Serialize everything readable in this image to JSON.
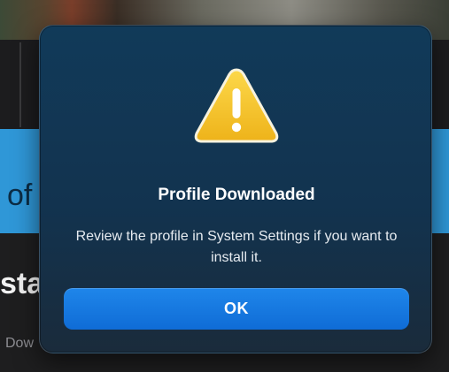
{
  "background": {
    "partial_text_left": "of",
    "partial_heading": "stal",
    "partial_button_text": "Dow"
  },
  "alert": {
    "icon": "warning-triangle-icon",
    "title": "Profile Downloaded",
    "message": "Review the profile in System Settings if you want to install it.",
    "ok_label": "OK"
  },
  "colors": {
    "alert_background": "#12334f",
    "button_accent": "#0f6cd6",
    "warning_yellow": "#f5c22b",
    "background_banner": "#2f97d7"
  }
}
